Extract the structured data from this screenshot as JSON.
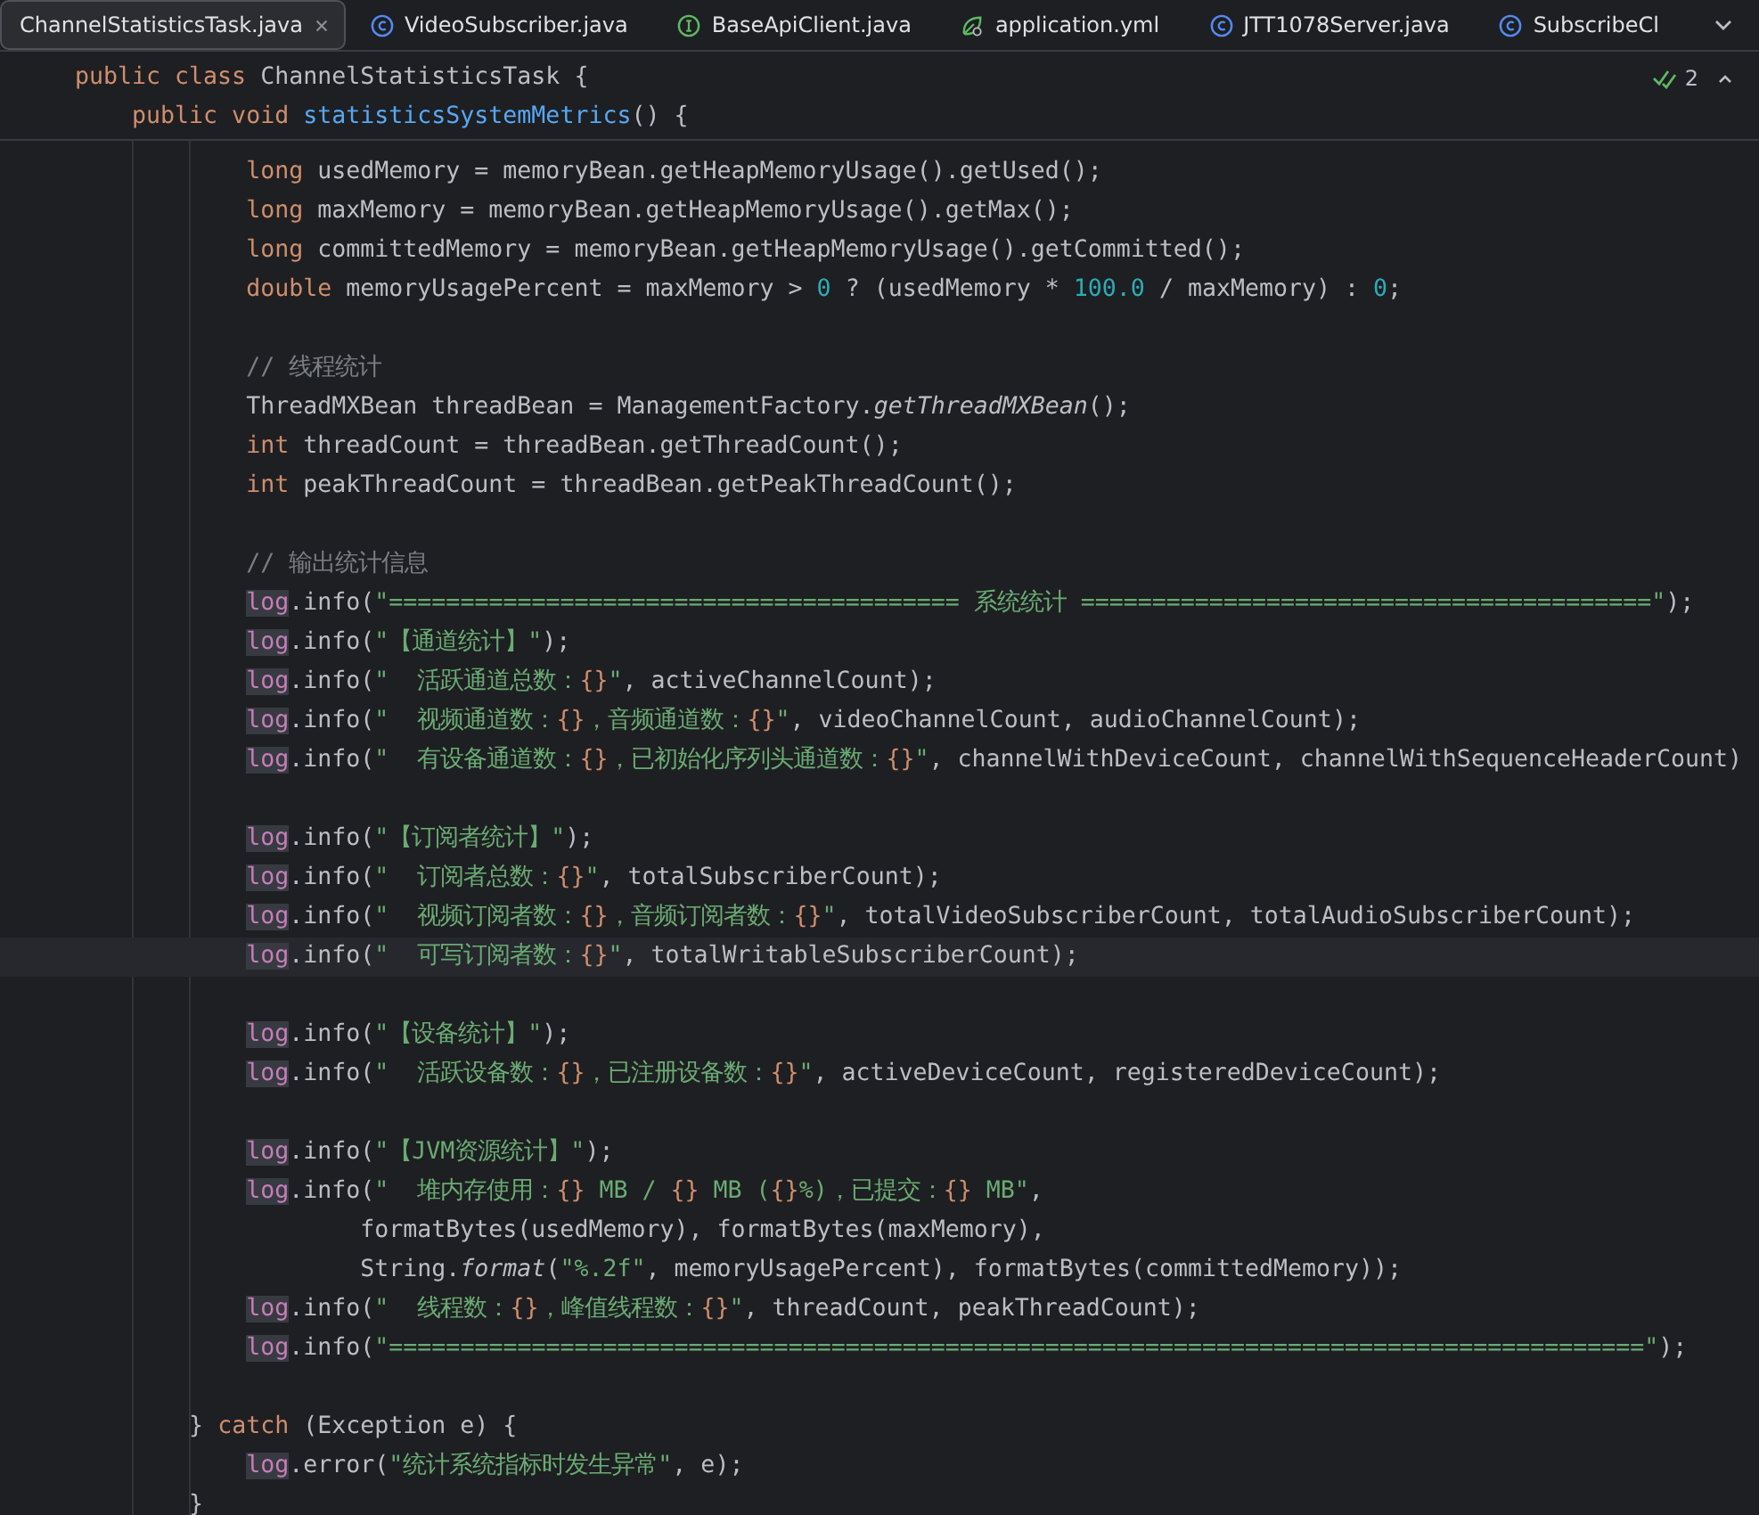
{
  "tabs": [
    {
      "label": "ChannelStatisticsTask.java",
      "kind": "plain",
      "selected": true,
      "closable": true
    },
    {
      "label": "VideoSubscriber.java",
      "kind": "class",
      "selected": false,
      "closable": false
    },
    {
      "label": "BaseApiClient.java",
      "kind": "interface",
      "selected": false,
      "closable": false
    },
    {
      "label": "application.yml",
      "kind": "yaml",
      "selected": false,
      "closable": false
    },
    {
      "label": "JTT1078Server.java",
      "kind": "class",
      "selected": false,
      "closable": false
    },
    {
      "label": "SubscribeCl",
      "kind": "class",
      "selected": false,
      "closable": false
    }
  ],
  "inspections": {
    "count": "2"
  },
  "sticky_lines": [
    {
      "tokens": [
        {
          "kind": "k",
          "text": "public class "
        },
        {
          "kind": "p",
          "text": "ChannelStatisticsTask {"
        }
      ]
    },
    {
      "tokens": [
        {
          "kind": "k",
          "text": "    public void "
        },
        {
          "kind": "m",
          "text": "statisticsSystemMetrics"
        },
        {
          "kind": "p",
          "text": "() {"
        }
      ]
    }
  ],
  "lines": [
    {
      "kind": "code",
      "current": false,
      "tokens": [
        {
          "kind": "k",
          "text": "            long "
        },
        {
          "kind": "p",
          "text": "usedMemory = memoryBean.getHeapMemoryUsage().getUsed();"
        }
      ]
    },
    {
      "kind": "code",
      "current": false,
      "tokens": [
        {
          "kind": "k",
          "text": "            long "
        },
        {
          "kind": "p",
          "text": "maxMemory = memoryBean.getHeapMemoryUsage().getMax();"
        }
      ]
    },
    {
      "kind": "code",
      "current": false,
      "tokens": [
        {
          "kind": "k",
          "text": "            long "
        },
        {
          "kind": "p",
          "text": "committedMemory = memoryBean.getHeapMemoryUsage().getCommitted();"
        }
      ]
    },
    {
      "kind": "code",
      "current": false,
      "tokens": [
        {
          "kind": "k",
          "text": "            double "
        },
        {
          "kind": "p",
          "text": "memoryUsagePercent = maxMemory > "
        },
        {
          "kind": "n",
          "text": "0"
        },
        {
          "kind": "p",
          "text": " ? (usedMemory * "
        },
        {
          "kind": "n",
          "text": "100.0"
        },
        {
          "kind": "p",
          "text": " / maxMemory) : "
        },
        {
          "kind": "n",
          "text": "0"
        },
        {
          "kind": "p",
          "text": ";"
        }
      ]
    },
    {
      "kind": "blank",
      "current": false
    },
    {
      "kind": "code",
      "current": false,
      "tokens": [
        {
          "kind": "c",
          "text": "            // 线程统计"
        }
      ]
    },
    {
      "kind": "code",
      "current": false,
      "tokens": [
        {
          "kind": "p",
          "text": "            ThreadMXBean threadBean = ManagementFactory."
        },
        {
          "kind": "i",
          "text": "getThreadMXBean"
        },
        {
          "kind": "p",
          "text": "();"
        }
      ]
    },
    {
      "kind": "code",
      "current": false,
      "tokens": [
        {
          "kind": "k",
          "text": "            int "
        },
        {
          "kind": "p",
          "text": "threadCount = threadBean.getThreadCount();"
        }
      ]
    },
    {
      "kind": "code",
      "current": false,
      "tokens": [
        {
          "kind": "k",
          "text": "            int "
        },
        {
          "kind": "p",
          "text": "peakThreadCount = threadBean.getPeakThreadCount();"
        }
      ]
    },
    {
      "kind": "blank",
      "current": false
    },
    {
      "kind": "code",
      "current": false,
      "tokens": [
        {
          "kind": "c",
          "text": "            // 输出统计信息"
        }
      ]
    },
    {
      "kind": "code",
      "current": false,
      "tokens": [
        {
          "kind": "f",
          "text": "            log"
        },
        {
          "kind": "p",
          "text": ".info("
        },
        {
          "kind": "s",
          "text": "\"======================================== 系统统计 ========================================\""
        },
        {
          "kind": "p",
          "text": ");"
        }
      ]
    },
    {
      "kind": "code",
      "current": false,
      "tokens": [
        {
          "kind": "f",
          "text": "            log"
        },
        {
          "kind": "p",
          "text": ".info("
        },
        {
          "kind": "s",
          "text": "\"【通道统计】\""
        },
        {
          "kind": "p",
          "text": ");"
        }
      ]
    },
    {
      "kind": "code",
      "current": false,
      "tokens": [
        {
          "kind": "f",
          "text": "            log"
        },
        {
          "kind": "p",
          "text": ".info("
        },
        {
          "kind": "s",
          "text": "\"  活跃通道总数："
        },
        {
          "kind": "h",
          "text": "{}"
        },
        {
          "kind": "s",
          "text": "\""
        },
        {
          "kind": "p",
          "text": ", activeChannelCount);"
        }
      ]
    },
    {
      "kind": "code",
      "current": false,
      "tokens": [
        {
          "kind": "f",
          "text": "            log"
        },
        {
          "kind": "p",
          "text": ".info("
        },
        {
          "kind": "s",
          "text": "\"  视频通道数："
        },
        {
          "kind": "h",
          "text": "{}"
        },
        {
          "kind": "s",
          "text": "，音频通道数："
        },
        {
          "kind": "h",
          "text": "{}"
        },
        {
          "kind": "s",
          "text": "\""
        },
        {
          "kind": "p",
          "text": ", videoChannelCount, audioChannelCount);"
        }
      ]
    },
    {
      "kind": "code",
      "current": false,
      "tokens": [
        {
          "kind": "f",
          "text": "            log"
        },
        {
          "kind": "p",
          "text": ".info("
        },
        {
          "kind": "s",
          "text": "\"  有设备通道数："
        },
        {
          "kind": "h",
          "text": "{}"
        },
        {
          "kind": "s",
          "text": "，已初始化序列头通道数："
        },
        {
          "kind": "h",
          "text": "{}"
        },
        {
          "kind": "s",
          "text": "\""
        },
        {
          "kind": "p",
          "text": ", channelWithDeviceCount, channelWithSequenceHeaderCount)"
        }
      ]
    },
    {
      "kind": "blank",
      "current": false
    },
    {
      "kind": "code",
      "current": false,
      "tokens": [
        {
          "kind": "f",
          "text": "            log"
        },
        {
          "kind": "p",
          "text": ".info("
        },
        {
          "kind": "s",
          "text": "\"【订阅者统计】\""
        },
        {
          "kind": "p",
          "text": ");"
        }
      ]
    },
    {
      "kind": "code",
      "current": false,
      "tokens": [
        {
          "kind": "f",
          "text": "            log"
        },
        {
          "kind": "p",
          "text": ".info("
        },
        {
          "kind": "s",
          "text": "\"  订阅者总数："
        },
        {
          "kind": "h",
          "text": "{}"
        },
        {
          "kind": "s",
          "text": "\""
        },
        {
          "kind": "p",
          "text": ", totalSubscriberCount);"
        }
      ]
    },
    {
      "kind": "code",
      "current": false,
      "tokens": [
        {
          "kind": "f",
          "text": "            log"
        },
        {
          "kind": "p",
          "text": ".info("
        },
        {
          "kind": "s",
          "text": "\"  视频订阅者数："
        },
        {
          "kind": "h",
          "text": "{}"
        },
        {
          "kind": "s",
          "text": "，音频订阅者数："
        },
        {
          "kind": "h",
          "text": "{}"
        },
        {
          "kind": "s",
          "text": "\""
        },
        {
          "kind": "p",
          "text": ", totalVideoSubscriberCount, totalAudioSubscriberCount);"
        }
      ]
    },
    {
      "kind": "code",
      "current": true,
      "tokens": [
        {
          "kind": "f",
          "text": "            log"
        },
        {
          "kind": "p",
          "text": ".info("
        },
        {
          "kind": "s",
          "text": "\"  可写订阅者数："
        },
        {
          "kind": "h",
          "text": "{}"
        },
        {
          "kind": "s",
          "text": "\""
        },
        {
          "kind": "p",
          "text": ", totalWritableSubscriberCount);"
        }
      ]
    },
    {
      "kind": "blank",
      "current": false
    },
    {
      "kind": "code",
      "current": false,
      "tokens": [
        {
          "kind": "f",
          "text": "            log"
        },
        {
          "kind": "p",
          "text": ".info("
        },
        {
          "kind": "s",
          "text": "\"【设备统计】\""
        },
        {
          "kind": "p",
          "text": ");"
        }
      ]
    },
    {
      "kind": "code",
      "current": false,
      "tokens": [
        {
          "kind": "f",
          "text": "            log"
        },
        {
          "kind": "p",
          "text": ".info("
        },
        {
          "kind": "s",
          "text": "\"  活跃设备数："
        },
        {
          "kind": "h",
          "text": "{}"
        },
        {
          "kind": "s",
          "text": "，已注册设备数："
        },
        {
          "kind": "h",
          "text": "{}"
        },
        {
          "kind": "s",
          "text": "\""
        },
        {
          "kind": "p",
          "text": ", activeDeviceCount, registeredDeviceCount);"
        }
      ]
    },
    {
      "kind": "blank",
      "current": false
    },
    {
      "kind": "code",
      "current": false,
      "tokens": [
        {
          "kind": "f",
          "text": "            log"
        },
        {
          "kind": "p",
          "text": ".info("
        },
        {
          "kind": "s",
          "text": "\"【JVM资源统计】\""
        },
        {
          "kind": "p",
          "text": ");"
        }
      ]
    },
    {
      "kind": "code",
      "current": false,
      "tokens": [
        {
          "kind": "f",
          "text": "            log"
        },
        {
          "kind": "p",
          "text": ".info("
        },
        {
          "kind": "s",
          "text": "\"  堆内存使用："
        },
        {
          "kind": "h",
          "text": "{}"
        },
        {
          "kind": "s",
          "text": " MB / "
        },
        {
          "kind": "h",
          "text": "{}"
        },
        {
          "kind": "s",
          "text": " MB ("
        },
        {
          "kind": "h",
          "text": "{}"
        },
        {
          "kind": "s",
          "text": "%)，已提交："
        },
        {
          "kind": "h",
          "text": "{}"
        },
        {
          "kind": "s",
          "text": " MB\""
        },
        {
          "kind": "p",
          "text": ","
        }
      ]
    },
    {
      "kind": "code",
      "current": false,
      "tokens": [
        {
          "kind": "p",
          "text": "                    formatBytes(usedMemory), formatBytes(maxMemory),"
        }
      ]
    },
    {
      "kind": "code",
      "current": false,
      "tokens": [
        {
          "kind": "p",
          "text": "                    String."
        },
        {
          "kind": "i",
          "text": "format"
        },
        {
          "kind": "p",
          "text": "("
        },
        {
          "kind": "s",
          "text": "\"%.2f\""
        },
        {
          "kind": "p",
          "text": ", memoryUsagePercent), formatBytes(committedMemory));"
        }
      ]
    },
    {
      "kind": "code",
      "current": false,
      "tokens": [
        {
          "kind": "f",
          "text": "            log"
        },
        {
          "kind": "p",
          "text": ".info("
        },
        {
          "kind": "s",
          "text": "\"  线程数："
        },
        {
          "kind": "h",
          "text": "{}"
        },
        {
          "kind": "s",
          "text": "，峰值线程数："
        },
        {
          "kind": "h",
          "text": "{}"
        },
        {
          "kind": "s",
          "text": "\""
        },
        {
          "kind": "p",
          "text": ", threadCount, peakThreadCount);"
        }
      ]
    },
    {
      "kind": "code",
      "current": false,
      "tokens": [
        {
          "kind": "f",
          "text": "            log"
        },
        {
          "kind": "p",
          "text": ".info("
        },
        {
          "kind": "s",
          "text": "\"========================================================================================\""
        },
        {
          "kind": "p",
          "text": ");"
        }
      ]
    },
    {
      "kind": "blank",
      "current": false
    },
    {
      "kind": "code",
      "current": false,
      "tokens": [
        {
          "kind": "p",
          "text": "        } "
        },
        {
          "kind": "k",
          "text": "catch"
        },
        {
          "kind": "p",
          "text": " (Exception e) {"
        }
      ]
    },
    {
      "kind": "code",
      "current": false,
      "tokens": [
        {
          "kind": "f",
          "text": "            log"
        },
        {
          "kind": "p",
          "text": ".error("
        },
        {
          "kind": "s",
          "text": "\"统计系统指标时发生异常\""
        },
        {
          "kind": "p",
          "text": ", e);"
        }
      ]
    },
    {
      "kind": "code",
      "current": false,
      "tokens": [
        {
          "kind": "p",
          "text": "        }"
        }
      ]
    }
  ]
}
